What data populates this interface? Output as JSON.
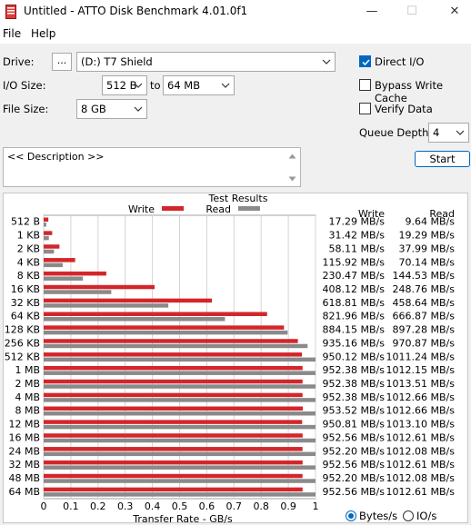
{
  "window": {
    "title": "Untitled - ATTO Disk Benchmark 4.01.0f1",
    "minimize_icon": "minimize-icon",
    "maximize_icon": "maximize-icon",
    "close_icon": "close-icon",
    "app_icon": "disk-drive-icon"
  },
  "menu": {
    "file": "File",
    "help": "Help"
  },
  "settings": {
    "drive_label": "Drive:",
    "drive_browse": "...",
    "drive_value": "(D:) T7 Shield",
    "io_size_label": "I/O Size:",
    "io_from": "512 B",
    "io_to_label": "to",
    "io_to": "64 MB",
    "file_size_label": "File Size:",
    "file_size": "8 GB",
    "direct_io": {
      "label": "Direct I/O",
      "checked": true
    },
    "bypass_write_cache": {
      "label": "Bypass Write Cache",
      "checked": false
    },
    "verify_data": {
      "label": "Verify Data",
      "checked": false
    },
    "queue_depth_label": "Queue Depth:",
    "queue_depth": "4",
    "start_label": "Start",
    "description": "<< Description >>"
  },
  "colors": {
    "write": "#d3262b",
    "read": "#8a8a8a",
    "accent": "#0067c0"
  },
  "chart_data": {
    "type": "bar",
    "title": "Test Results",
    "xlabel": "Transfer Rate - GB/s",
    "xlim": [
      0,
      1
    ],
    "x_ticks": [
      "0",
      "0.1",
      "0.2",
      "0.3",
      "0.4",
      "0.5",
      "0.6",
      "0.7",
      "0.8",
      "0.9",
      "1"
    ],
    "categories": [
      "512 B",
      "1 KB",
      "2 KB",
      "4 KB",
      "8 KB",
      "16 KB",
      "32 KB",
      "64 KB",
      "128 KB",
      "256 KB",
      "512 KB",
      "1 MB",
      "2 MB",
      "4 MB",
      "8 MB",
      "12 MB",
      "16 MB",
      "24 MB",
      "32 MB",
      "48 MB",
      "64 MB"
    ],
    "series": [
      {
        "name": "Write",
        "values": [
          0.01729,
          0.03142,
          0.05811,
          0.11592,
          0.23047,
          0.40812,
          0.61881,
          0.82196,
          0.88415,
          0.93516,
          0.95012,
          0.95238,
          0.95238,
          0.95238,
          0.95352,
          0.95081,
          0.95256,
          0.9522,
          0.95256,
          0.9522,
          0.95256
        ]
      },
      {
        "name": "Read",
        "values": [
          0.00964,
          0.01929,
          0.03799,
          0.07014,
          0.14453,
          0.24876,
          0.45864,
          0.66687,
          0.89728,
          0.97087,
          1.01124,
          1.01215,
          1.01351,
          1.01266,
          1.01266,
          1.0131,
          1.01261,
          1.01208,
          1.01261,
          1.01208,
          1.01261
        ]
      }
    ],
    "write_column_header": "Write",
    "read_column_header": "Read",
    "write_labels": [
      "17.29 MB/s",
      "31.42 MB/s",
      "58.11 MB/s",
      "115.92 MB/s",
      "230.47 MB/s",
      "408.12 MB/s",
      "618.81 MB/s",
      "821.96 MB/s",
      "884.15 MB/s",
      "935.16 MB/s",
      "950.12 MB/s",
      "952.38 MB/s",
      "952.38 MB/s",
      "952.38 MB/s",
      "953.52 MB/s",
      "950.81 MB/s",
      "952.56 MB/s",
      "952.20 MB/s",
      "952.56 MB/s",
      "952.20 MB/s",
      "952.56 MB/s"
    ],
    "read_labels": [
      "9.64 MB/s",
      "19.29 MB/s",
      "37.99 MB/s",
      "70.14 MB/s",
      "144.53 MB/s",
      "248.76 MB/s",
      "458.64 MB/s",
      "666.87 MB/s",
      "897.28 MB/s",
      "970.87 MB/s",
      "1011.24 MB/s",
      "1012.15 MB/s",
      "1013.51 MB/s",
      "1012.66 MB/s",
      "1012.66 MB/s",
      "1013.10 MB/s",
      "1012.61 MB/s",
      "1012.08 MB/s",
      "1012.61 MB/s",
      "1012.08 MB/s",
      "1012.61 MB/s"
    ],
    "grid": true,
    "legend": "top"
  },
  "units": {
    "bytes_label": "Bytes/s",
    "io_label": "IO/s",
    "selected": "bytes"
  }
}
